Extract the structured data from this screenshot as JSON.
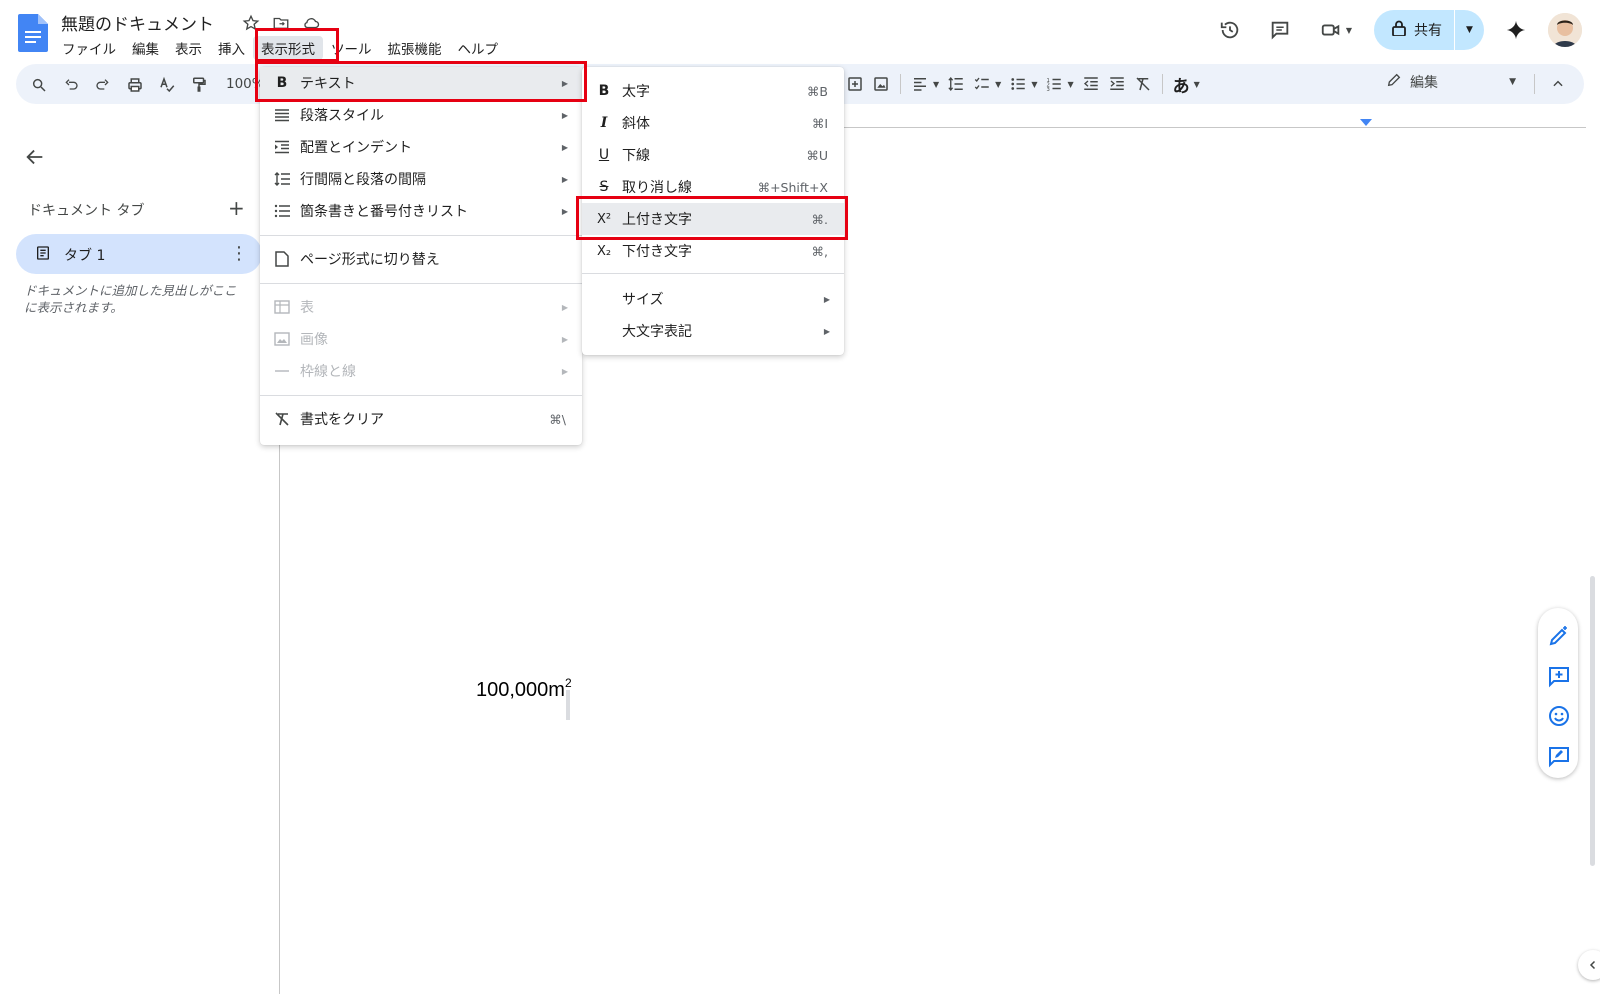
{
  "document": {
    "title": "無題のドキュメント",
    "body_text": "100,000m",
    "superscript": "2"
  },
  "menubar": {
    "items": [
      "ファイル",
      "編集",
      "表示",
      "挿入",
      "表示形式",
      "ツール",
      "拡張機能",
      "ヘルプ"
    ],
    "active": "表示形式"
  },
  "toolbar": {
    "zoom": "100%",
    "input_tool": "あ",
    "mode_label": "編集"
  },
  "share": {
    "label": "共有"
  },
  "sidebar": {
    "tabs_header": "ドキュメント タブ",
    "tab_label": "タブ 1",
    "outline_note": "ドキュメントに追加した見出しがここに表示されます。"
  },
  "format_menu": {
    "items": [
      {
        "label": "テキスト",
        "icon": "bold-b-icon",
        "submenu": true,
        "highlighted": true
      },
      {
        "label": "段落スタイル",
        "icon": "paragraph-icon",
        "submenu": true
      },
      {
        "label": "配置とインデント",
        "icon": "indent-icon",
        "submenu": true
      },
      {
        "label": "行間隔と段落の間隔",
        "icon": "line-spacing-icon",
        "submenu": true
      },
      {
        "label": "箇条書きと番号付きリスト",
        "icon": "list-icon",
        "submenu": true
      },
      {
        "label": "ページ形式に切り替え",
        "icon": "page-icon",
        "submenu": false
      },
      {
        "label": "表",
        "icon": "table-icon",
        "submenu": true,
        "disabled": true
      },
      {
        "label": "画像",
        "icon": "image-icon",
        "submenu": true,
        "disabled": true
      },
      {
        "label": "枠線と線",
        "icon": "border-icon",
        "submenu": true,
        "disabled": true
      },
      {
        "label": "書式をクリア",
        "icon": "clear-format-icon",
        "shortcut": "⌘\\"
      }
    ]
  },
  "text_submenu": {
    "items": [
      {
        "label": "太字",
        "icon_text": "B",
        "shortcut": "⌘B"
      },
      {
        "label": "斜体",
        "icon_text": "I",
        "shortcut": "⌘I"
      },
      {
        "label": "下線",
        "icon_text": "U",
        "shortcut": "⌘U"
      },
      {
        "label": "取り消し線",
        "icon_text": "S",
        "shortcut": "⌘+Shift+X"
      },
      {
        "label": "上付き文字",
        "icon_text": "X²",
        "shortcut": "⌘.",
        "highlighted": true
      },
      {
        "label": "下付き文字",
        "icon_text": "X₂",
        "shortcut": "⌘,"
      },
      {
        "label": "サイズ",
        "submenu": true
      },
      {
        "label": "大文字表記",
        "submenu": true
      }
    ]
  },
  "colors": {
    "accent_blue": "#1a73e8",
    "share_bg": "#c2e7ff",
    "highlight_red": "#e60012",
    "toolbar_bg": "#edf2fa"
  }
}
